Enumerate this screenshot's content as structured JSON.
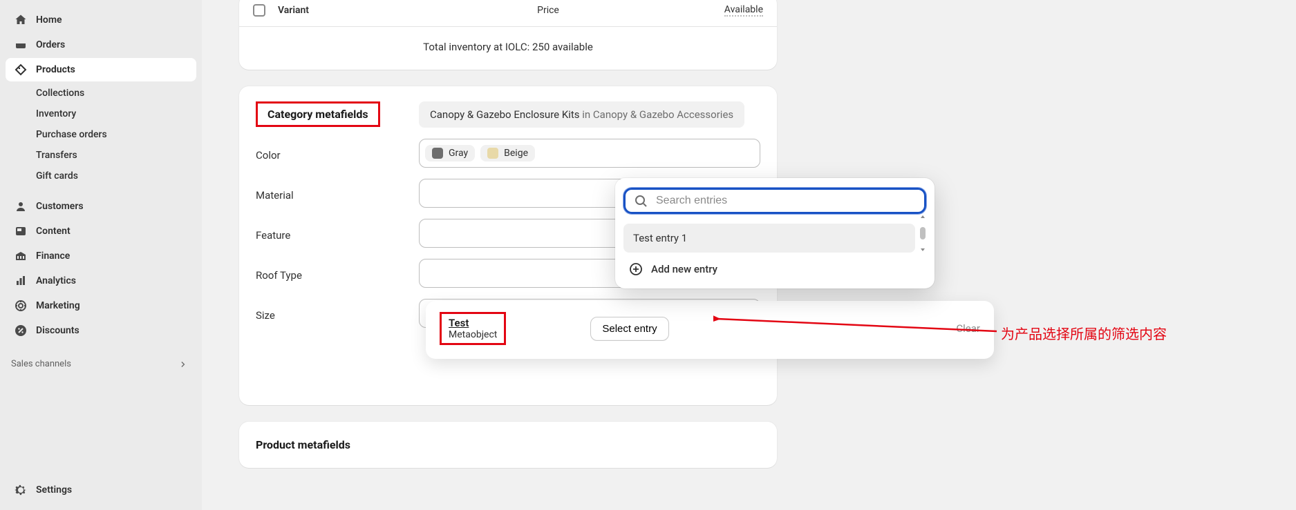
{
  "sidebar": {
    "items": [
      {
        "label": "Home"
      },
      {
        "label": "Orders"
      },
      {
        "label": "Products"
      },
      {
        "label": "Customers"
      },
      {
        "label": "Content"
      },
      {
        "label": "Finance"
      },
      {
        "label": "Analytics"
      },
      {
        "label": "Marketing"
      },
      {
        "label": "Discounts"
      }
    ],
    "product_sub": [
      {
        "label": "Collections"
      },
      {
        "label": "Inventory"
      },
      {
        "label": "Purchase orders"
      },
      {
        "label": "Transfers"
      },
      {
        "label": "Gift cards"
      }
    ],
    "sales_channels_label": "Sales channels",
    "settings_label": "Settings"
  },
  "variant_header": {
    "variant_col": "Variant",
    "price_col": "Price",
    "available_col": "Available"
  },
  "inventory_line": "Total inventory at IOLC: 250 available",
  "category_metafields": {
    "title": "Category metafields",
    "path_strong": "Canopy & Gazebo Enclosure Kits",
    "path_tail": " in Canopy & Gazebo Accessories",
    "rows": {
      "color_label": "Color",
      "material_label": "Material",
      "feature_label": "Feature",
      "roof_type_label": "Roof Type",
      "size_label": "Size"
    },
    "color_chips": [
      {
        "label": "Gray"
      },
      {
        "label": "Beige"
      }
    ]
  },
  "popover": {
    "search_placeholder": "Search entries",
    "entry1": "Test entry 1",
    "add_new": "Add new entry"
  },
  "select_entry_row": {
    "test_title": "Test",
    "test_sub": "Metaobject",
    "button": "Select entry",
    "clear": "Clear"
  },
  "annotation": "为产品选择所属的筛选内容",
  "product_metafields_title": "Product metafields"
}
